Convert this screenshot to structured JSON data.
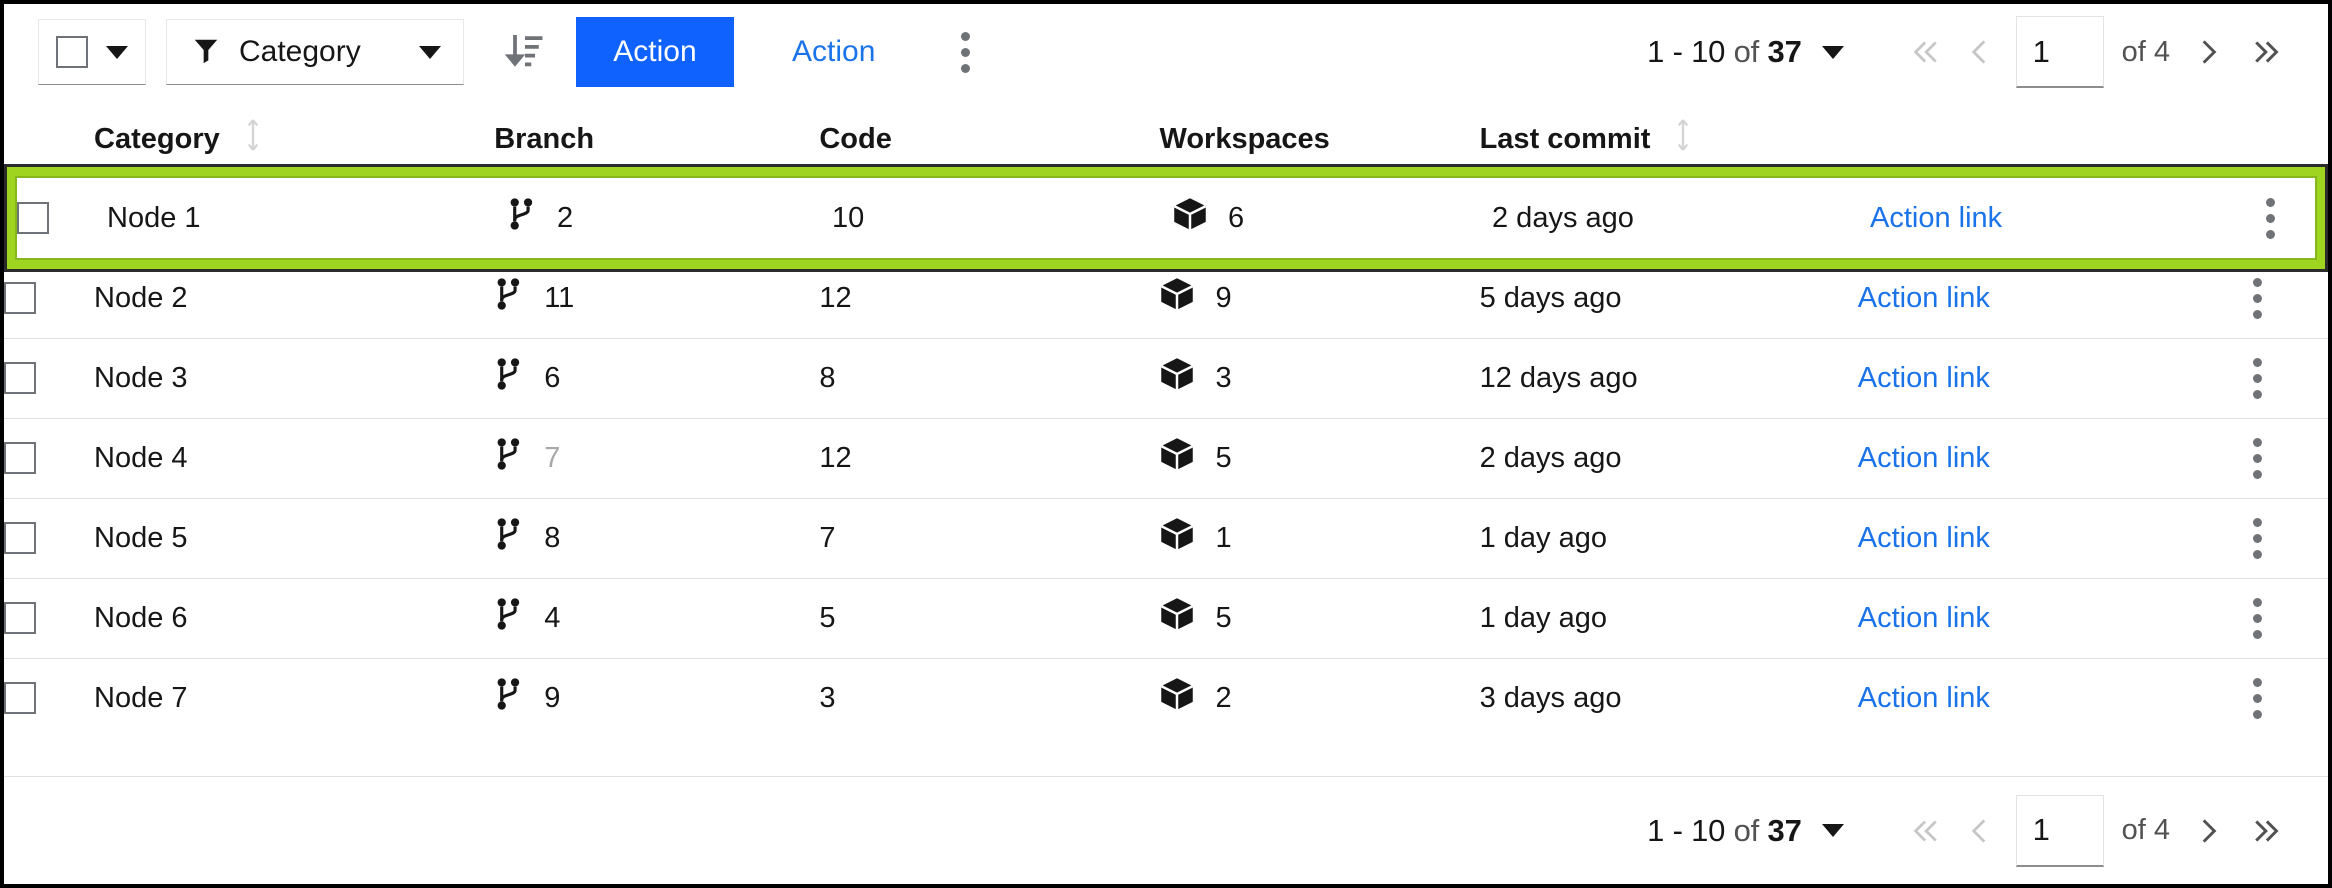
{
  "toolbar": {
    "select_all_checkbox": "",
    "filter_label": "Category",
    "sort_icon": "sort-descending-icon",
    "primary_action_label": "Action",
    "ghost_action_label": "Action",
    "overflow_icon": "overflow-menu-vertical-icon"
  },
  "pagination": {
    "range_start_end": "1 - 10",
    "of_word": "of",
    "total": "37",
    "page_value": "1",
    "page_of": "of 4",
    "first_icon": "chevron-double-left-icon",
    "prev_icon": "chevron-left-icon",
    "next_icon": "chevron-right-icon",
    "last_icon": "chevron-double-right-icon"
  },
  "table": {
    "columns": [
      {
        "label": "Category",
        "sortable": true
      },
      {
        "label": "Branch",
        "sortable": false
      },
      {
        "label": "Code",
        "sortable": false
      },
      {
        "label": "Workspaces",
        "sortable": false
      },
      {
        "label": "Last commit",
        "sortable": true
      },
      {
        "label": "",
        "sortable": false
      }
    ],
    "branch_icon": "git-branch-icon",
    "workspace_icon": "cube-icon",
    "row_menu_icon": "overflow-menu-vertical-icon",
    "rows": [
      {
        "category": "Node 1",
        "branch": "2",
        "code": "10",
        "workspaces": "6",
        "last_commit": "2 days ago",
        "action": "Action link",
        "selected": true,
        "branch_dim": false
      },
      {
        "category": "Node 2",
        "branch": "11",
        "code": "12",
        "workspaces": "9",
        "last_commit": "5 days ago",
        "action": "Action link",
        "selected": false,
        "branch_dim": false
      },
      {
        "category": "Node 3",
        "branch": "6",
        "code": "8",
        "workspaces": "3",
        "last_commit": "12 days ago",
        "action": "Action link",
        "selected": false,
        "branch_dim": false
      },
      {
        "category": "Node 4",
        "branch": "7",
        "code": "12",
        "workspaces": "5",
        "last_commit": "2 days ago",
        "action": "Action link",
        "selected": false,
        "branch_dim": true
      },
      {
        "category": "Node 5",
        "branch": "8",
        "code": "7",
        "workspaces": "1",
        "last_commit": "1 day ago",
        "action": "Action link",
        "selected": false,
        "branch_dim": false
      },
      {
        "category": "Node 6",
        "branch": "4",
        "code": "5",
        "workspaces": "5",
        "last_commit": "1 day ago",
        "action": "Action link",
        "selected": false,
        "branch_dim": false
      },
      {
        "category": "Node 7",
        "branch": "9",
        "code": "3",
        "workspaces": "2",
        "last_commit": "3 days ago",
        "action": "Action link",
        "selected": false,
        "branch_dim": false
      }
    ]
  },
  "bottom_pagination": {
    "range_start_end": "1 - 10",
    "of_word": "of",
    "total": "37",
    "page_value": "1",
    "page_of": "of 4"
  },
  "colors": {
    "primary_blue": "#0f62fe",
    "link_blue": "#1a73e8",
    "highlight_green": "#9fd420",
    "highlight_border": "#2b2b2b",
    "frame_border": "#000000"
  }
}
